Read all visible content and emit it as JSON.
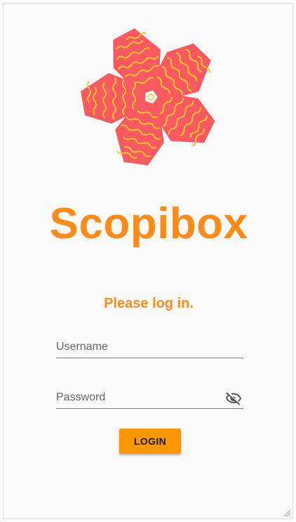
{
  "app": {
    "brand_name": "Scopibox",
    "logo_icon": "star-flower-logo-icon"
  },
  "login": {
    "heading": "Please log in.",
    "username_placeholder": "Username",
    "password_placeholder": "Password",
    "password_visibility_icon": "eye-off-icon",
    "submit_label": "LOGIN"
  },
  "colors": {
    "brand_orange": "#ff8c1a",
    "button_orange": "#ff9800",
    "logo_coral": "#fa5a5f",
    "logo_lines": "#ffc52e",
    "background": "#fafafa"
  }
}
